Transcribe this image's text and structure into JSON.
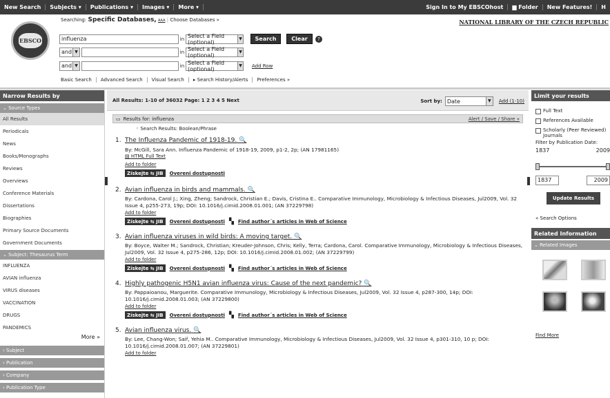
{
  "topnav": {
    "left": [
      "New Search",
      "Subjects ▾",
      "Publications ▾",
      "Images ▾",
      "More ▾"
    ],
    "right": [
      "Sign In to My EBSCOhost",
      "Folder",
      "New Features!",
      "H"
    ]
  },
  "logo": {
    "text": "EBSCO"
  },
  "searching": {
    "prefix": "Searching:",
    "dbs": "Specific Databases,",
    "small": "AAA",
    "choose": "Choose Databases »"
  },
  "library": "NATIONAL LIBRARY OF THE CZECH REPUBLIC",
  "search": {
    "rows": [
      {
        "op": "",
        "value": "influenza",
        "in": "in",
        "field": "Select a Field (optional)"
      },
      {
        "op": "and",
        "value": "",
        "in": "in",
        "field": "Select a Field (optional)"
      },
      {
        "op": "and",
        "value": "",
        "in": "in",
        "field": "Select a Field (optional)"
      }
    ],
    "search_btn": "Search",
    "clear_btn": "Clear",
    "help": "?",
    "add_row": "Add Row"
  },
  "sublinks": [
    "Basic Search",
    "Advanced Search",
    "Visual Search",
    "▸ Search History/Alerts",
    "Preferences »"
  ],
  "left": {
    "header": "Narrow Results by",
    "source_types_header": "Source Types",
    "source_types": [
      "All Results",
      "Periodicals",
      "News",
      "Books/Monographs",
      "Reviews",
      "Overviews",
      "Conference Materials",
      "Dissertations",
      "Biographies",
      "Primary Source Documents",
      "Government Documents"
    ],
    "thesaurus_header": "Subject: Thesaurus Term",
    "thesaurus": [
      "INFLUENZA",
      "AVIAN influenza",
      "VIRUS diseases",
      "VACCINATION",
      "DRUGS",
      "PANDEMICS"
    ],
    "more": "More »",
    "other_sections": [
      "Subject",
      "Publication",
      "Company",
      "Publication Type"
    ]
  },
  "results": {
    "summary": "All Results: 1-10 of 36032   Page: 1 2 3 4 5 Next",
    "sort_label": "Sort by:",
    "sort_value": "Date",
    "add_range": "Add (1-10)",
    "results_for": "Results for: influenza",
    "alert": "Alert / Save / Share »",
    "boolean": "Search Results: Boolean/Phrase",
    "items": [
      {
        "num": "1.",
        "title": "The Influenza Pandemic of 1918-19.",
        "by": "By: McGill, Sara Ann. Influenza Pandemic of 1918-19, 2009, p1-2, 2p; (AN 17981165)",
        "html": "HTML Full Text",
        "add": "Add to folder",
        "z": "Získejte ⇆ JIB",
        "ov": "Overeni dostupnosti",
        "wos": ""
      },
      {
        "num": "2.",
        "title": "Avian influenza in birds and mammals.",
        "by": "By: Cardona, Carol J.; Xing, Zheng; Sandrock, Christian E.; Davis, Cristina E.. Comparative Immunology, Microbiology & Infectious Diseases, Jul2009, Vol. 32 Issue 4, p255-273, 19p; DOI: 10.1016/j.cimid.2008.01.001; (AN 37229798)",
        "html": "",
        "add": "Add to folder",
        "z": "Získejte ⇆ JIB",
        "ov": "Overeni dostupnosti",
        "wos": "Find author´s articles in Web of Science"
      },
      {
        "num": "3.",
        "title": "Avian influenza viruses in wild birds: A moving target.",
        "by": "By: Boyce, Walter M.; Sandrock, Christian; Kreuder-Johnson, Chris; Kelly, Terra; Cardona, Carol. Comparative Immunology, Microbiology & Infectious Diseases, Jul2009, Vol. 32 Issue 4, p275-286, 12p; DOI: 10.1016/j.cimid.2008.01.002; (AN 37229799)",
        "html": "",
        "add": "Add to folder",
        "z": "Získejte ⇆ JIB",
        "ov": "Overeni dostupnosti",
        "wos": "Find author´s articles in Web of Science"
      },
      {
        "num": "4.",
        "title": "Highly pathogenic H5N1 avian influenza virus: Cause of the next pandemic?",
        "by": "By: Pappaioanou, Marguerite. Comparative Immunology, Microbiology & Infectious Diseases, Jul2009, Vol. 32 Issue 4, p287-300, 14p; DOI: 10.1016/j.cimid.2008.01.003; (AN 37229800)",
        "html": "",
        "add": "Add to folder",
        "z": "Získejte ⇆ JIB",
        "ov": "Overeni dostupnosti",
        "wos": "Find author´s articles in Web of Science"
      },
      {
        "num": "5.",
        "title": "Avian influenza virus.",
        "by": "By: Lee, Chang-Won; Saif, Yehia M.. Comparative Immunology, Microbiology & Infectious Diseases, Jul2009, Vol. 32 Issue 4, p301-310, 10 p; DOI: 10.1016/j.cimid.2008.01.007; (AN 37229801)",
        "html": "",
        "add": "Add to folder",
        "z": "",
        "ov": "",
        "wos": ""
      }
    ]
  },
  "right": {
    "header": "Limit your results",
    "checkboxes": [
      "Full Text",
      "References Available",
      "Scholarly (Peer Reviewed) Journals"
    ],
    "filter_label": "Filter by Publication Date:",
    "date_from": "1837",
    "date_to": "2009",
    "update": "Update Results",
    "search_options": "« Search Options",
    "related_header": "Related Information",
    "related_images": "Related Images",
    "find_more": "Find More"
  }
}
